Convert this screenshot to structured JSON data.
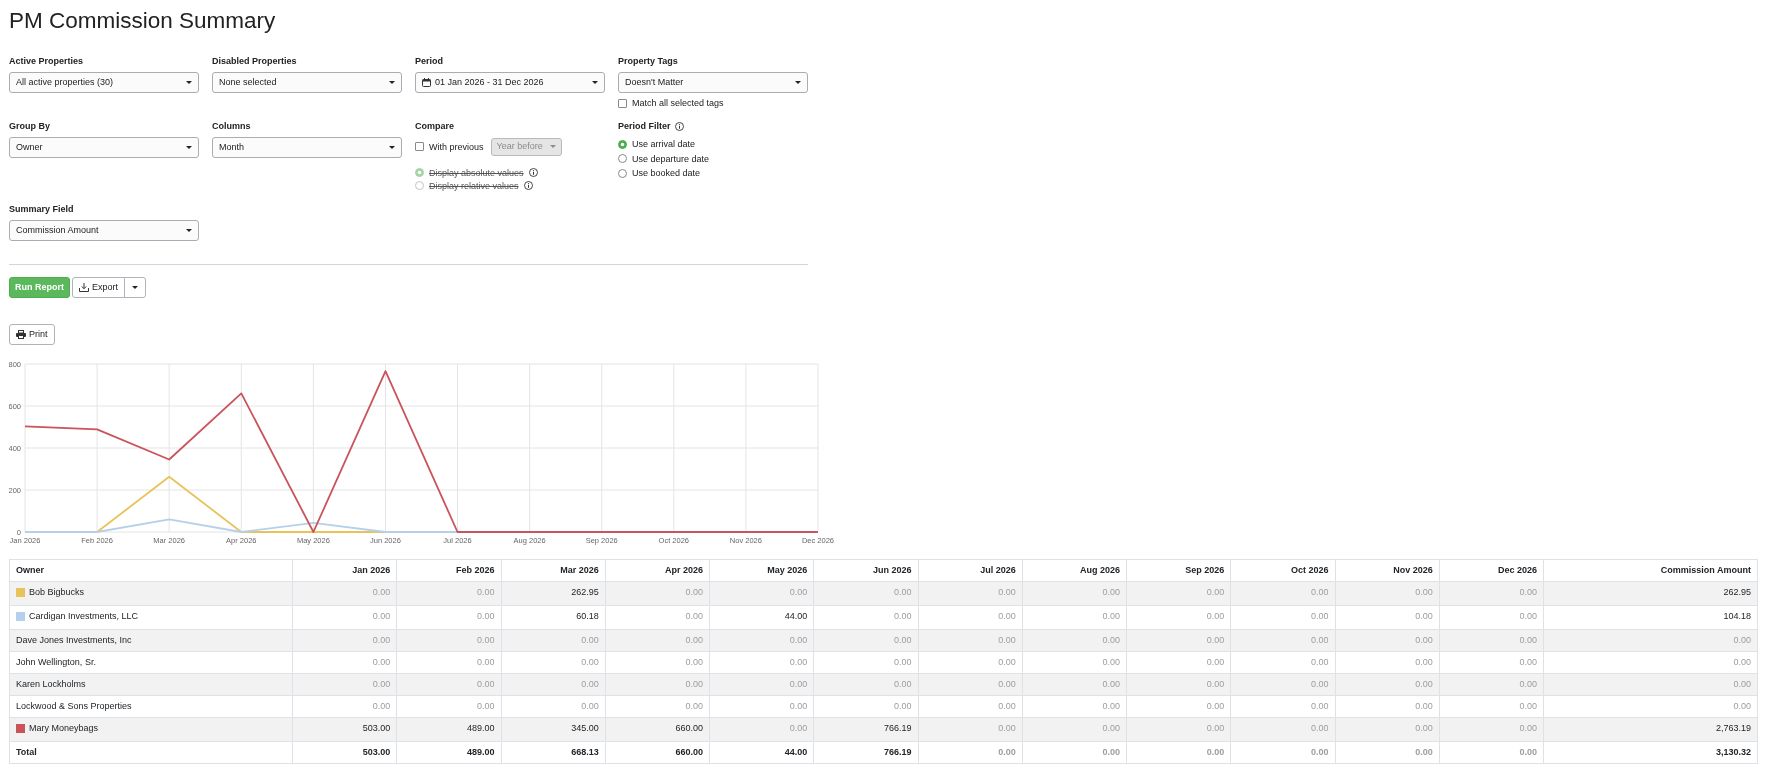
{
  "page": {
    "title": "PM Commission Summary"
  },
  "filters": [
    {
      "label": "Active Properties",
      "kind": "select",
      "value": "All active properties (30)"
    },
    {
      "label": "Disabled Properties",
      "kind": "select",
      "value": "None selected"
    },
    {
      "label": "Period",
      "kind": "date",
      "value": "01 Jan 2026 - 31 Dec 2026"
    },
    {
      "label": "Property Tags",
      "kind": "select",
      "value": "Doesn't Matter",
      "checkbox": {
        "label": "Match all selected tags",
        "checked": false
      }
    },
    {
      "label": "Group By",
      "kind": "select",
      "value": "Owner"
    },
    {
      "label": "Columns",
      "kind": "select",
      "value": "Month"
    },
    {
      "label": "Compare",
      "kind": "compare",
      "checkbox": {
        "label": "With previous",
        "checked": false
      },
      "period_select": {
        "value": "Year before",
        "disabled": true
      },
      "options": [
        {
          "label": "Display absolute values",
          "selected": true,
          "disabled": true,
          "info": true
        },
        {
          "label": "Display relative values",
          "selected": false,
          "disabled": true,
          "info": true
        }
      ]
    },
    {
      "label": "Period Filter",
      "kind": "radios",
      "info": true,
      "options": [
        {
          "label": "Use arrival date",
          "selected": true
        },
        {
          "label": "Use departure date",
          "selected": false
        },
        {
          "label": "Use booked date",
          "selected": false
        }
      ]
    },
    {
      "label": "Summary Field",
      "kind": "select",
      "value": "Commission Amount"
    }
  ],
  "buttons": {
    "run_report": "Run Report",
    "export": "Export",
    "print": "Print"
  },
  "chart": {
    "chart_data": {
      "type": "line",
      "categories": [
        "Jan 2026",
        "Feb 2026",
        "Mar 2026",
        "Apr 2026",
        "May 2026",
        "Jun 2026",
        "Jul 2026",
        "Aug 2026",
        "Sep 2026",
        "Oct 2026",
        "Nov 2026",
        "Dec 2026"
      ],
      "series": [
        {
          "color": "#e8c35a",
          "values": [
            null,
            0,
            263,
            0,
            0,
            0,
            null,
            null,
            null,
            null,
            null,
            null
          ]
        },
        {
          "color": "#b4d0ea",
          "values": [
            0,
            0,
            60,
            0,
            44,
            0,
            0,
            null,
            null,
            null,
            null,
            null
          ]
        },
        {
          "color": "#c9545a",
          "values": [
            503,
            489,
            345,
            660,
            0,
            766,
            0,
            0,
            0,
            0,
            0,
            0
          ]
        }
      ],
      "ylim": [
        0,
        800
      ],
      "yticks": [
        0,
        200,
        400,
        600,
        800
      ],
      "grid": true
    }
  },
  "table": {
    "columns": [
      "Owner",
      "Jan 2026",
      "Feb 2026",
      "Mar 2026",
      "Apr 2026",
      "May 2026",
      "Jun 2026",
      "Jul 2026",
      "Aug 2026",
      "Sep 2026",
      "Oct 2026",
      "Nov 2026",
      "Dec 2026",
      "Commission Amount"
    ],
    "rows": [
      {
        "owner": "Bob Bigbucks",
        "color": "#e8c35a",
        "values": [
          "0.00",
          "0.00",
          "262.95",
          "0.00",
          "0.00",
          "0.00",
          "0.00",
          "0.00",
          "0.00",
          "0.00",
          "0.00",
          "0.00",
          "262.95"
        ]
      },
      {
        "owner": "Cardigan Investments, LLC",
        "color": "#b4d0ea",
        "values": [
          "0.00",
          "0.00",
          "60.18",
          "0.00",
          "44.00",
          "0.00",
          "0.00",
          "0.00",
          "0.00",
          "0.00",
          "0.00",
          "0.00",
          "104.18"
        ]
      },
      {
        "owner": "Dave Jones Investments, Inc",
        "values": [
          "0.00",
          "0.00",
          "0.00",
          "0.00",
          "0.00",
          "0.00",
          "0.00",
          "0.00",
          "0.00",
          "0.00",
          "0.00",
          "0.00",
          "0.00"
        ]
      },
      {
        "owner": "John Wellington, Sr.",
        "values": [
          "0.00",
          "0.00",
          "0.00",
          "0.00",
          "0.00",
          "0.00",
          "0.00",
          "0.00",
          "0.00",
          "0.00",
          "0.00",
          "0.00",
          "0.00"
        ]
      },
      {
        "owner": "Karen Lockholms",
        "values": [
          "0.00",
          "0.00",
          "0.00",
          "0.00",
          "0.00",
          "0.00",
          "0.00",
          "0.00",
          "0.00",
          "0.00",
          "0.00",
          "0.00",
          "0.00"
        ]
      },
      {
        "owner": "Lockwood & Sons Properties",
        "values": [
          "0.00",
          "0.00",
          "0.00",
          "0.00",
          "0.00",
          "0.00",
          "0.00",
          "0.00",
          "0.00",
          "0.00",
          "0.00",
          "0.00",
          "0.00"
        ]
      },
      {
        "owner": "Mary Moneybags",
        "color": "#c9545a",
        "values": [
          "503.00",
          "489.00",
          "345.00",
          "660.00",
          "0.00",
          "766.19",
          "0.00",
          "0.00",
          "0.00",
          "0.00",
          "0.00",
          "0.00",
          "2,763.19"
        ]
      }
    ],
    "total": {
      "label": "Total",
      "values": [
        "503.00",
        "489.00",
        "668.13",
        "660.00",
        "44.00",
        "766.19",
        "0.00",
        "0.00",
        "0.00",
        "0.00",
        "0.00",
        "0.00",
        "3,130.32"
      ]
    }
  }
}
